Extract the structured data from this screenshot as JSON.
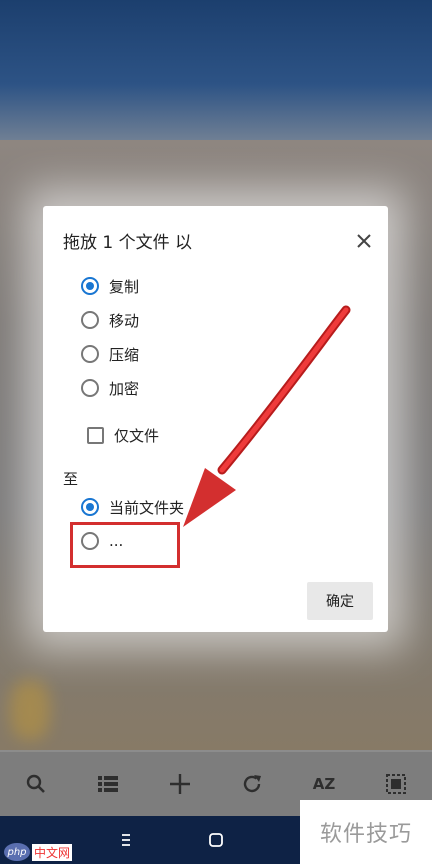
{
  "dialog": {
    "title": "拖放 1 个文件 以",
    "actions": [
      {
        "label": "复制",
        "selected": true
      },
      {
        "label": "移动",
        "selected": false
      },
      {
        "label": "压缩",
        "selected": false
      },
      {
        "label": "加密",
        "selected": false
      }
    ],
    "files_only_label": "仅文件",
    "files_only_checked": false,
    "destination_heading": "至",
    "destinations": [
      {
        "label": "当前文件夹",
        "selected": true
      },
      {
        "label": "...",
        "selected": false
      }
    ],
    "ok_label": "确定"
  },
  "toolbar": {
    "icons": [
      "search-icon",
      "list-view-icon",
      "add-icon",
      "refresh-icon",
      "sort-az-icon",
      "select-all-icon"
    ],
    "sort_label": "AZ"
  },
  "navbar": {
    "icons": [
      "menu-icon",
      "home-icon"
    ]
  },
  "watermarks": {
    "right": "软件技巧",
    "left_logo": "php",
    "left_text": "中文网"
  },
  "colors": {
    "accent": "#1976d2",
    "annotation": "#d32f2f",
    "nav_background": "#0e2245"
  }
}
